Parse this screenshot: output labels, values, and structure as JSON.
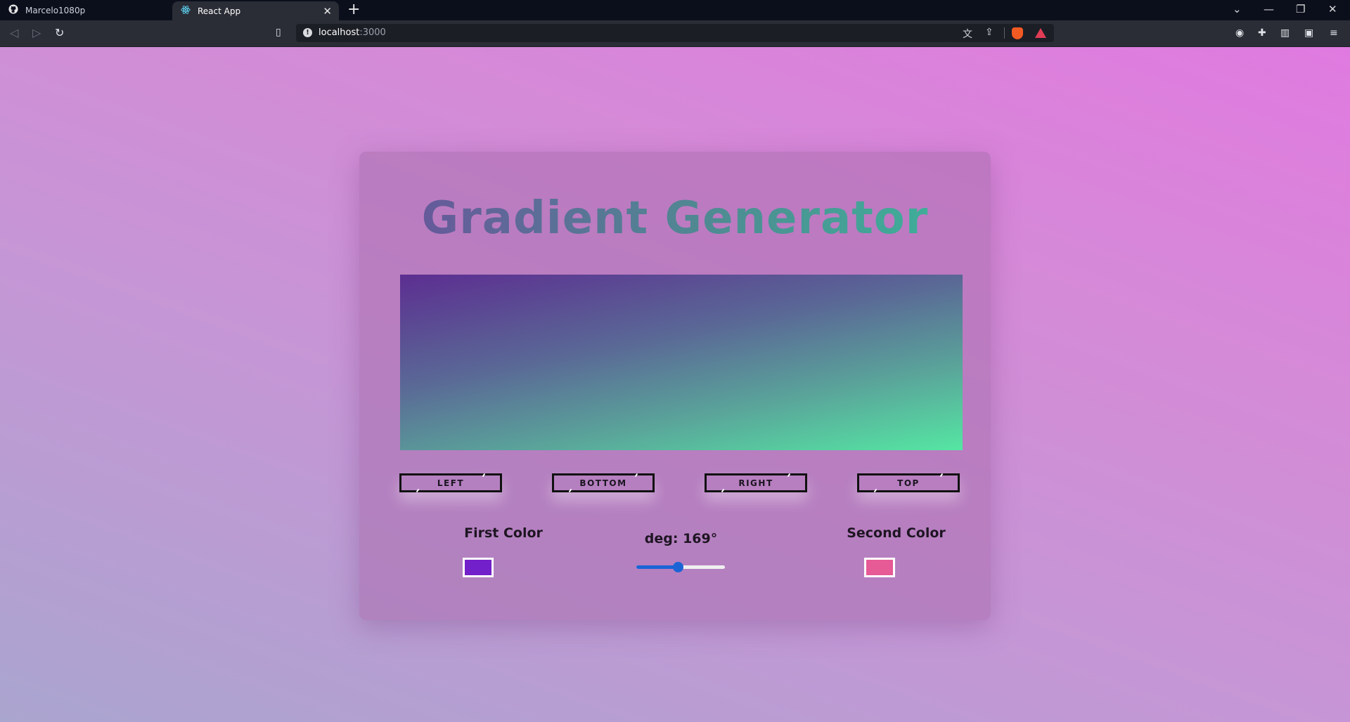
{
  "browser": {
    "tabs": [
      {
        "title": "Marcelo1080p",
        "icon": "github-icon"
      },
      {
        "title": "React App",
        "icon": "react-icon"
      }
    ],
    "url_host": "localhost",
    "url_port": ":3000"
  },
  "app": {
    "title": "Gradient Generator",
    "gradient": {
      "first_color": "#7220c9",
      "second_color": "#e65a96",
      "deg": 169
    },
    "buttons": [
      "LEFT",
      "BOTTOM",
      "RIGHT",
      "TOP"
    ],
    "first_color_label": "First Color",
    "second_color_label": "Second Color",
    "deg_label": "deg: 169°"
  },
  "colors": {
    "preview_start": "#5c2e91",
    "preview_end": "#55e6a3",
    "slider_accent": "#1b64d6"
  }
}
